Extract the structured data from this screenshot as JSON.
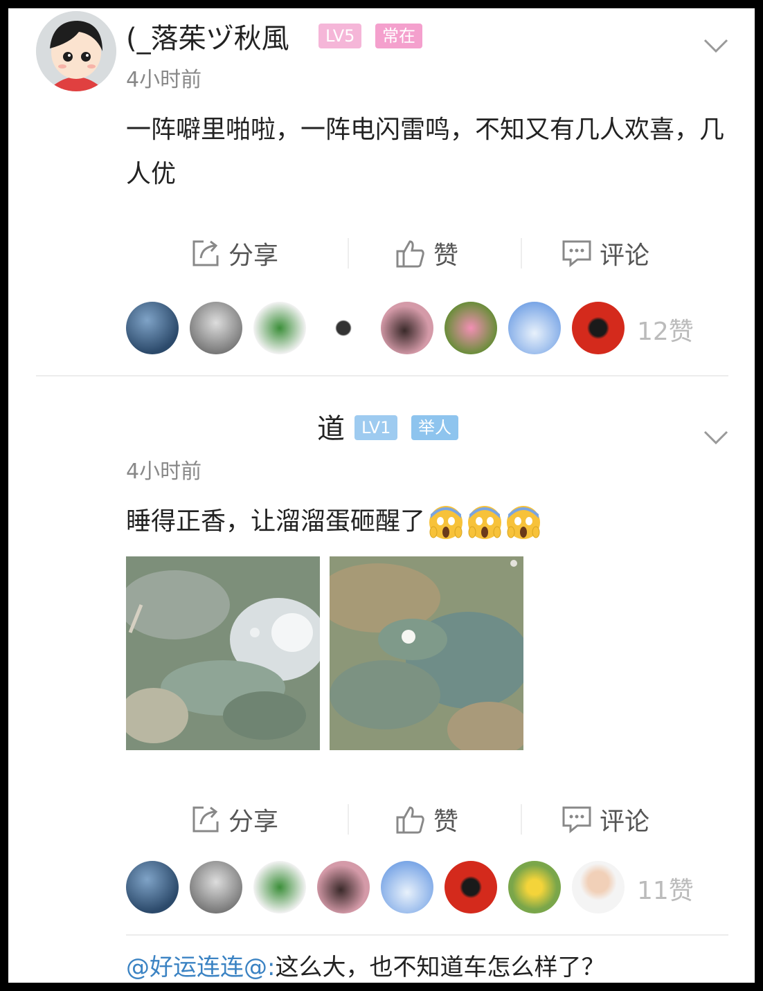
{
  "posts": [
    {
      "username": "(_落茱ヅ秋風",
      "badges": [
        "LV5",
        "常在"
      ],
      "time": "4小时前",
      "text": "一阵噼里啪啦，一阵电闪雷鸣，不知又有几人欢喜，几人优",
      "actions": {
        "share": "分享",
        "like": "赞",
        "comment": "评论"
      },
      "like_count": "12赞"
    },
    {
      "username": "道",
      "badges": [
        "LV1",
        "举人"
      ],
      "time": "4小时前",
      "text": "睡得正香，让溜溜蛋砸醒了",
      "actions": {
        "share": "分享",
        "like": "赞",
        "comment": "评论"
      },
      "like_count": "11赞"
    }
  ],
  "reply": {
    "mention": "@好运连连@:",
    "text": "这么大，也不知道车怎么样了？"
  },
  "colors": {
    "lv5_badge": "#f5b6d8",
    "rank_badge_pink": "#f4a0cd",
    "lv1_badge": "#9ecbf0",
    "rank_badge_blue": "#8ec4ee",
    "mention": "#3b83c3"
  }
}
